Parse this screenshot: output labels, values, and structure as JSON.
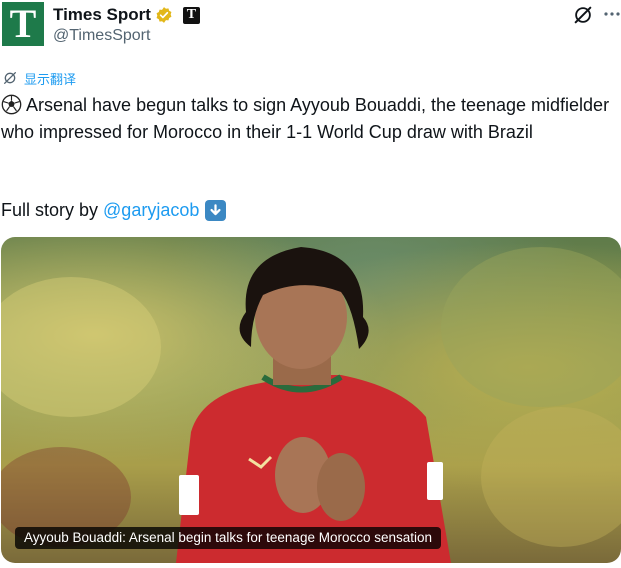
{
  "account": {
    "display_name": "Times Sport",
    "handle": "@TimesSport",
    "avatar_letter": "T",
    "badge_letter": "T",
    "avatar_color": "#1e7a4a",
    "verified_color": "#e2b719"
  },
  "actions": {
    "grok_icon": "grok-icon",
    "more_icon": "more-icon"
  },
  "translate": {
    "label": "显示翻译"
  },
  "tweet": {
    "text": "Arsenal have begun talks to sign Ayyoub Bouaddi, the teenage midfielder who impressed for Morocco in their 1-1 World Cup draw with Brazil",
    "full_story_prefix": "Full story by",
    "mention": "@garyjacob"
  },
  "media": {
    "caption": "Ayyoub Bouaddi: Arsenal begin talks for teenage Morocco sensation"
  },
  "colors": {
    "link": "#1d9bf0",
    "muted": "#536471",
    "text": "#0f1419"
  }
}
